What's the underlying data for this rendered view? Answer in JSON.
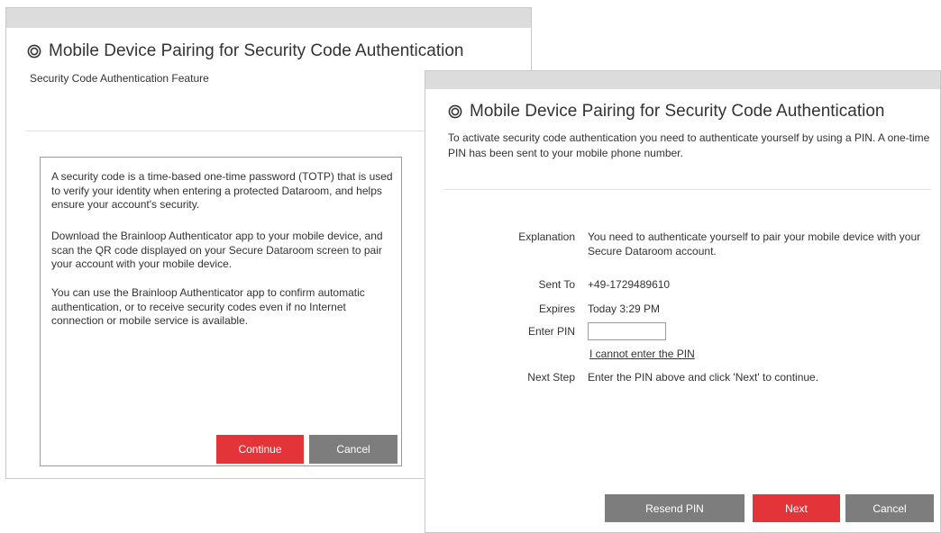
{
  "feature_dialog": {
    "title": "Mobile Device Pairing for Security Code Authentication",
    "subtitle": "Security Code Authentication Feature",
    "paragraphs": [
      "A security code is a time-based one-time password (TOTP) that is used to verify your identity when entering a protected Dataroom, and helps ensure your account's security.",
      "Download the Brainloop Authenticator app to your mobile device, and scan the QR code displayed on your Secure Dataroom screen to pair your account with your mobile device.",
      "You can use the Brainloop Authenticator app to confirm automatic authentication, or to receive security codes even if no Internet connection or mobile service is available."
    ],
    "continue_label": "Continue",
    "cancel_label": "Cancel"
  },
  "pin_dialog": {
    "title": "Mobile Device Pairing for Security Code Authentication",
    "subtitle": "To activate security code authentication you need to authenticate yourself by using a PIN. A one-time PIN has been sent to your mobile phone number.",
    "fields": {
      "explanation_label": "Explanation",
      "explanation_value": "You need to authenticate yourself to pair your mobile device with your Secure Dataroom account.",
      "sent_to_label": "Sent To",
      "sent_to_value": "+49-1729489610",
      "expires_label": "Expires",
      "expires_value": "Today 3:29 PM",
      "enter_pin_label": "Enter PIN",
      "pin_value": "",
      "cannot_enter_link": "I cannot enter the PIN",
      "next_step_label": "Next Step",
      "next_step_value": "Enter the PIN above and click 'Next' to continue."
    },
    "resend_label": "Resend PIN",
    "next_label": "Next",
    "cancel_label": "Cancel"
  },
  "icons": {
    "title_icon": "target-circle-icon"
  },
  "colors": {
    "primary_button": "#e3343a",
    "secondary_button": "#7d7d7d",
    "titlebar": "#dcdcdc",
    "text": "#333333"
  }
}
